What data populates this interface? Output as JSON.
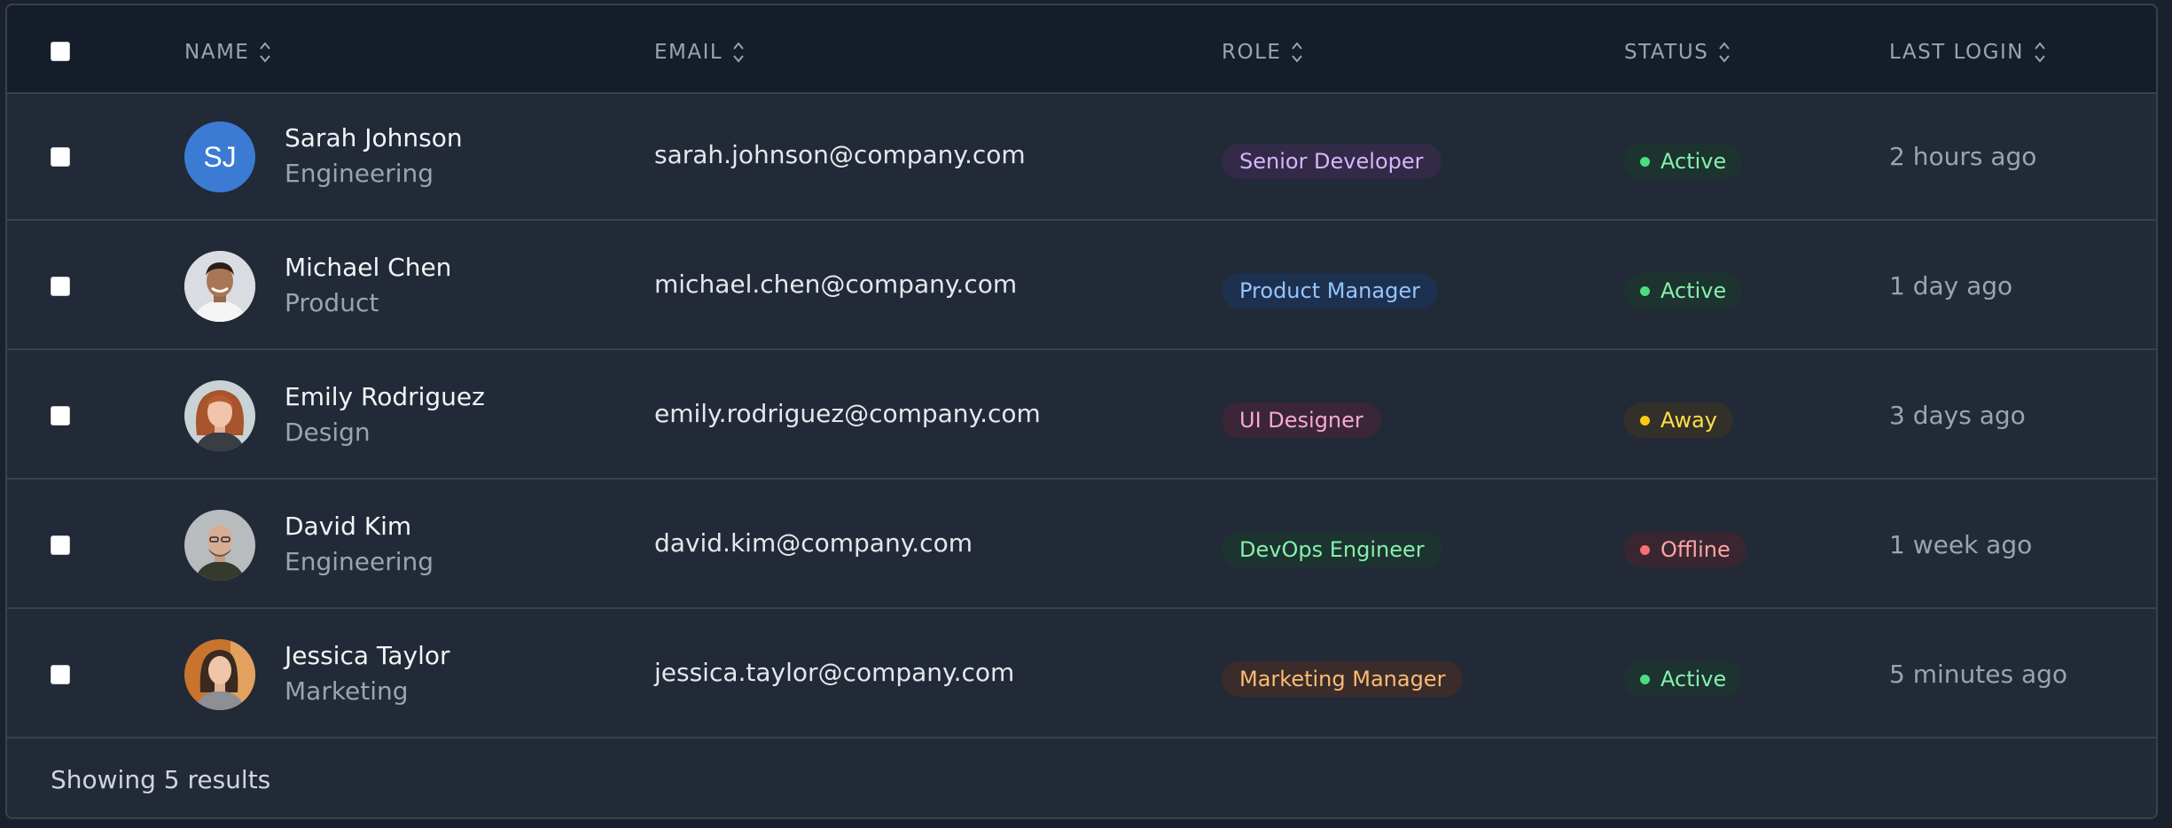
{
  "columns": {
    "name": "NAME",
    "email": "EMAIL",
    "role": "ROLE",
    "status": "STATUS",
    "last_login": "LAST LOGIN"
  },
  "rows": [
    {
      "name": "Sarah Johnson",
      "department": "Engineering",
      "initials": "SJ",
      "avatar": "initials",
      "email": "sarah.johnson@company.com",
      "role": "Senior Developer",
      "role_color": "#d8b4fe",
      "role_bg": "#322a46",
      "status": "Active",
      "status_color": "#86efac",
      "status_dot": "#4ade80",
      "status_bg": "#1d3330",
      "last_login": "2 hours ago"
    },
    {
      "name": "Michael Chen",
      "department": "Product",
      "avatar": "photo",
      "email": "michael.chen@company.com",
      "role": "Product Manager",
      "role_color": "#93c5fd",
      "role_bg": "#1e3050",
      "status": "Active",
      "status_color": "#86efac",
      "status_dot": "#4ade80",
      "status_bg": "#1d3330",
      "last_login": "1 day ago"
    },
    {
      "name": "Emily Rodriguez",
      "department": "Design",
      "avatar": "photo",
      "email": "emily.rodriguez@company.com",
      "role": "UI Designer",
      "role_color": "#f9a8d4",
      "role_bg": "#3a2636",
      "status": "Away",
      "status_color": "#fde047",
      "status_dot": "#facc15",
      "status_bg": "#33302a",
      "last_login": "3 days ago"
    },
    {
      "name": "David Kim",
      "department": "Engineering",
      "avatar": "photo",
      "email": "david.kim@company.com",
      "role": "DevOps Engineer",
      "role_color": "#86efac",
      "role_bg": "#1d3330",
      "status": "Offline",
      "status_color": "#fca5a5",
      "status_dot": "#f87171",
      "status_bg": "#3a2630",
      "last_login": "1 week ago"
    },
    {
      "name": "Jessica Taylor",
      "department": "Marketing",
      "avatar": "photo",
      "email": "jessica.taylor@company.com",
      "role": "Marketing Manager",
      "role_color": "#fdba74",
      "role_bg": "#3a2c2a",
      "status": "Active",
      "status_color": "#86efac",
      "status_dot": "#4ade80",
      "status_bg": "#1d3330",
      "last_login": "5 minutes ago"
    }
  ],
  "footer": {
    "results_text": "Showing 5 results"
  },
  "icons": {
    "sort": "sort-icon"
  }
}
